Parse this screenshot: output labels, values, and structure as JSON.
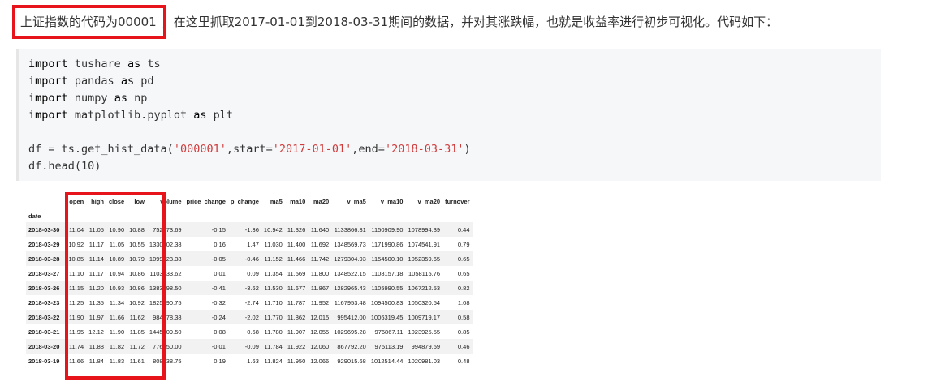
{
  "intro": {
    "highlighted": "上证指数的代码为00001",
    "rest": "，在这里抓取2017-01-01到2018-03-31期间的数据，并对其涨跌幅，也就是收益率进行初步可视化。代码如下："
  },
  "code": {
    "lines": [
      "import tushare as ts",
      "import pandas as pd",
      "import numpy as np",
      "import matplotlib.pyplot as plt",
      "",
      "df = ts.get_hist_data('000001',start='2017-01-01',end='2018-03-31')",
      "df.head(10)"
    ]
  },
  "table": {
    "index_name": "date",
    "columns": [
      "open",
      "high",
      "close",
      "low",
      "volume",
      "price_change",
      "p_change",
      "ma5",
      "ma10",
      "ma20",
      "v_ma5",
      "v_ma10",
      "v_ma20",
      "turnover"
    ],
    "rows": [
      [
        "2018-03-30",
        "11.04",
        "11.05",
        "10.90",
        "10.88",
        "752173.69",
        "-0.15",
        "-1.36",
        "10.942",
        "11.326",
        "11.640",
        "1133866.31",
        "1150909.90",
        "1078994.39",
        "0.44"
      ],
      [
        "2018-03-29",
        "10.92",
        "11.17",
        "11.05",
        "10.55",
        "1330602.38",
        "0.16",
        "1.47",
        "11.030",
        "11.400",
        "11.692",
        "1348569.73",
        "1171990.86",
        "1074541.91",
        "0.79"
      ],
      [
        "2018-03-28",
        "10.85",
        "11.14",
        "10.89",
        "10.79",
        "1099023.38",
        "-0.05",
        "-0.46",
        "11.152",
        "11.466",
        "11.742",
        "1279304.93",
        "1154500.10",
        "1052359.65",
        "0.65"
      ],
      [
        "2018-03-27",
        "11.10",
        "11.17",
        "10.94",
        "10.86",
        "1103933.62",
        "0.01",
        "0.09",
        "11.354",
        "11.569",
        "11.800",
        "1348522.15",
        "1108157.18",
        "1058115.76",
        "0.65"
      ],
      [
        "2018-03-26",
        "11.15",
        "11.20",
        "10.93",
        "10.86",
        "1383598.50",
        "-0.41",
        "-3.62",
        "11.530",
        "11.677",
        "11.867",
        "1282965.43",
        "1105990.55",
        "1067212.53",
        "0.82"
      ],
      [
        "2018-03-23",
        "11.25",
        "11.35",
        "11.34",
        "10.92",
        "1825690.75",
        "-0.32",
        "-2.74",
        "11.710",
        "11.787",
        "11.952",
        "1167953.48",
        "1094500.83",
        "1050320.54",
        "1.08"
      ],
      [
        "2018-03-22",
        "11.90",
        "11.97",
        "11.66",
        "11.62",
        "984278.38",
        "-0.24",
        "-2.02",
        "11.770",
        "11.862",
        "12.015",
        "995412.00",
        "1006319.45",
        "1009719.17",
        "0.58"
      ],
      [
        "2018-03-21",
        "11.95",
        "12.12",
        "11.90",
        "11.85",
        "1445109.50",
        "0.08",
        "0.68",
        "11.780",
        "11.907",
        "12.055",
        "1029695.28",
        "976867.11",
        "1023925.55",
        "0.85"
      ],
      [
        "2018-03-20",
        "11.74",
        "11.88",
        "11.82",
        "11.72",
        "776150.00",
        "-0.01",
        "-0.09",
        "11.784",
        "11.922",
        "12.060",
        "867792.20",
        "975113.19",
        "994879.59",
        "0.46"
      ],
      [
        "2018-03-19",
        "11.66",
        "11.84",
        "11.83",
        "11.61",
        "808538.75",
        "0.19",
        "1.63",
        "11.824",
        "11.950",
        "12.066",
        "929015.68",
        "1012514.44",
        "1020981.03",
        "0.48"
      ]
    ]
  },
  "colors": {
    "highlight": "#e8141c",
    "code_bg": "#f6f7f9",
    "string": "#d03c3c"
  }
}
